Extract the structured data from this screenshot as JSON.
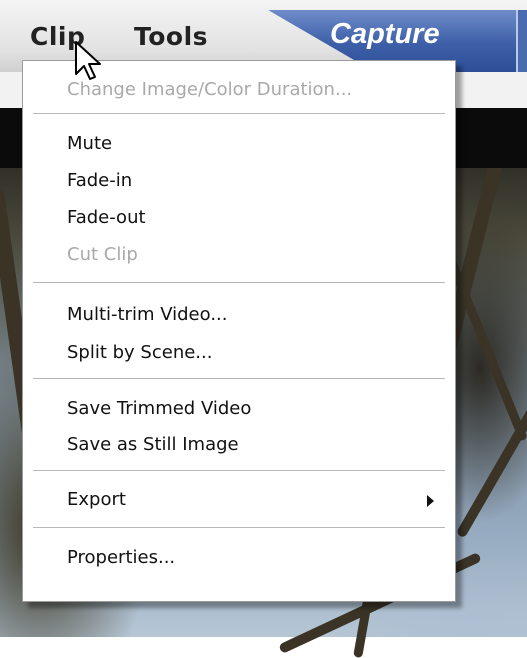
{
  "menubar": {
    "clip_label": "Clip",
    "tools_label": "Tools",
    "capture_tab_label": "Capture"
  },
  "dropdown": {
    "items": [
      {
        "label": "Change Image/Color Duration...",
        "enabled": false
      },
      {
        "label": "Mute",
        "enabled": true
      },
      {
        "label": "Fade-in",
        "enabled": true
      },
      {
        "label": "Fade-out",
        "enabled": true
      },
      {
        "label": "Cut Clip",
        "enabled": false
      },
      {
        "label": "Multi-trim Video...",
        "enabled": true
      },
      {
        "label": "Split by Scene...",
        "enabled": true
      },
      {
        "label": "Save Trimmed Video",
        "enabled": true
      },
      {
        "label": "Save as Still Image",
        "enabled": true
      },
      {
        "label": "Export",
        "enabled": true,
        "submenu": true
      },
      {
        "label": "Properties...",
        "enabled": true
      }
    ]
  },
  "icons": {
    "cursor": "arrow-pointer-icon",
    "submenu": "submenu-arrow-icon"
  },
  "colors": {
    "capture_tab": "#3d5fa8",
    "disabled_text": "#a9a9a9"
  }
}
